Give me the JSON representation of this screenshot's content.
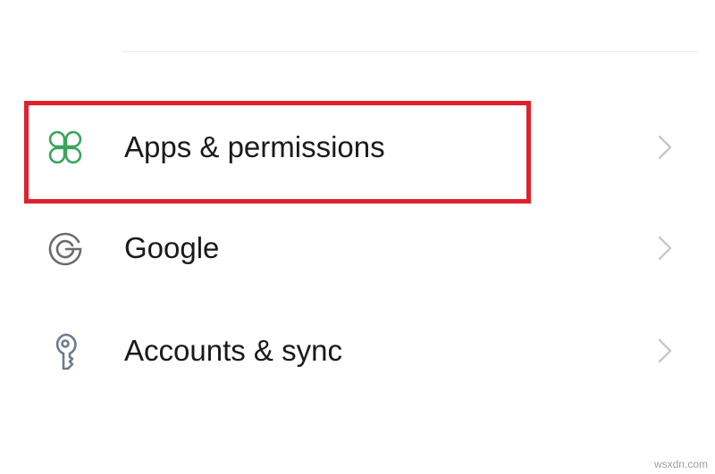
{
  "settings": {
    "items": [
      {
        "label": "Apps & permissions",
        "icon": "apps-grid-icon",
        "icon_color": "#3aa55a"
      },
      {
        "label": "Google",
        "icon": "google-g-icon",
        "icon_color": "#6b6b6b"
      },
      {
        "label": "Accounts & sync",
        "icon": "key-icon",
        "icon_color": "#6b7a90"
      }
    ]
  },
  "colors": {
    "highlight": "#e0202e",
    "chevron": "#c8c8c8",
    "text": "#1a1a1a"
  },
  "watermark": "wsxdn.com"
}
